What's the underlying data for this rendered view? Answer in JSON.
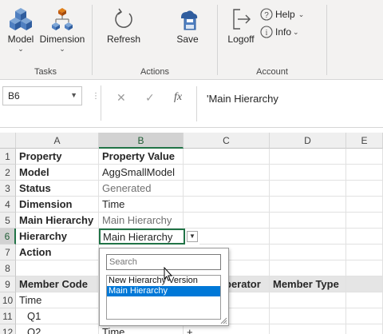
{
  "ribbon": {
    "tasks": {
      "model_label": "Model",
      "dimension_label": "Dimension",
      "group_label": "Tasks"
    },
    "actions": {
      "refresh_label": "Refresh",
      "save_label": "Save",
      "group_label": "Actions"
    },
    "account": {
      "logoff_label": "Logoff",
      "help_label": "Help",
      "info_label": "Info",
      "group_label": "Account"
    }
  },
  "formula_bar": {
    "name_box": "B6",
    "formula": "'Main Hierarchy",
    "fx_label": "fx"
  },
  "columns": [
    "A",
    "B",
    "C",
    "D",
    "E"
  ],
  "rows": [
    "1",
    "2",
    "3",
    "4",
    "5",
    "6",
    "7",
    "8",
    "9",
    "10",
    "11",
    "12"
  ],
  "cells": {
    "A1": "Property",
    "B1": "Property Value",
    "A2": "Model",
    "B2": "AggSmallModel",
    "A3": "Status",
    "B3": "Generated",
    "A4": "Dimension",
    "B4": "Time",
    "A5": "Main Hierarchy",
    "B5": "Main Hierarchy",
    "A6": "Hierarchy",
    "B6": "Main Hierarchy",
    "A7": "Action",
    "A9": "Member Code",
    "C9": "perator",
    "D9": "Member Type",
    "A10": "Time",
    "A11": "Q1",
    "A12": "Q2",
    "B12": "Time",
    "C12": "+"
  },
  "dropdown": {
    "search_placeholder": "Search",
    "options": [
      "New Hierarchy Version",
      "Main Hierarchy"
    ],
    "selected": "Main Hierarchy"
  },
  "colors": {
    "accent": "#217346",
    "selection": "#0078d7",
    "ribbon_bg": "#f3f2f1",
    "header_bg": "#e5e5e5"
  }
}
